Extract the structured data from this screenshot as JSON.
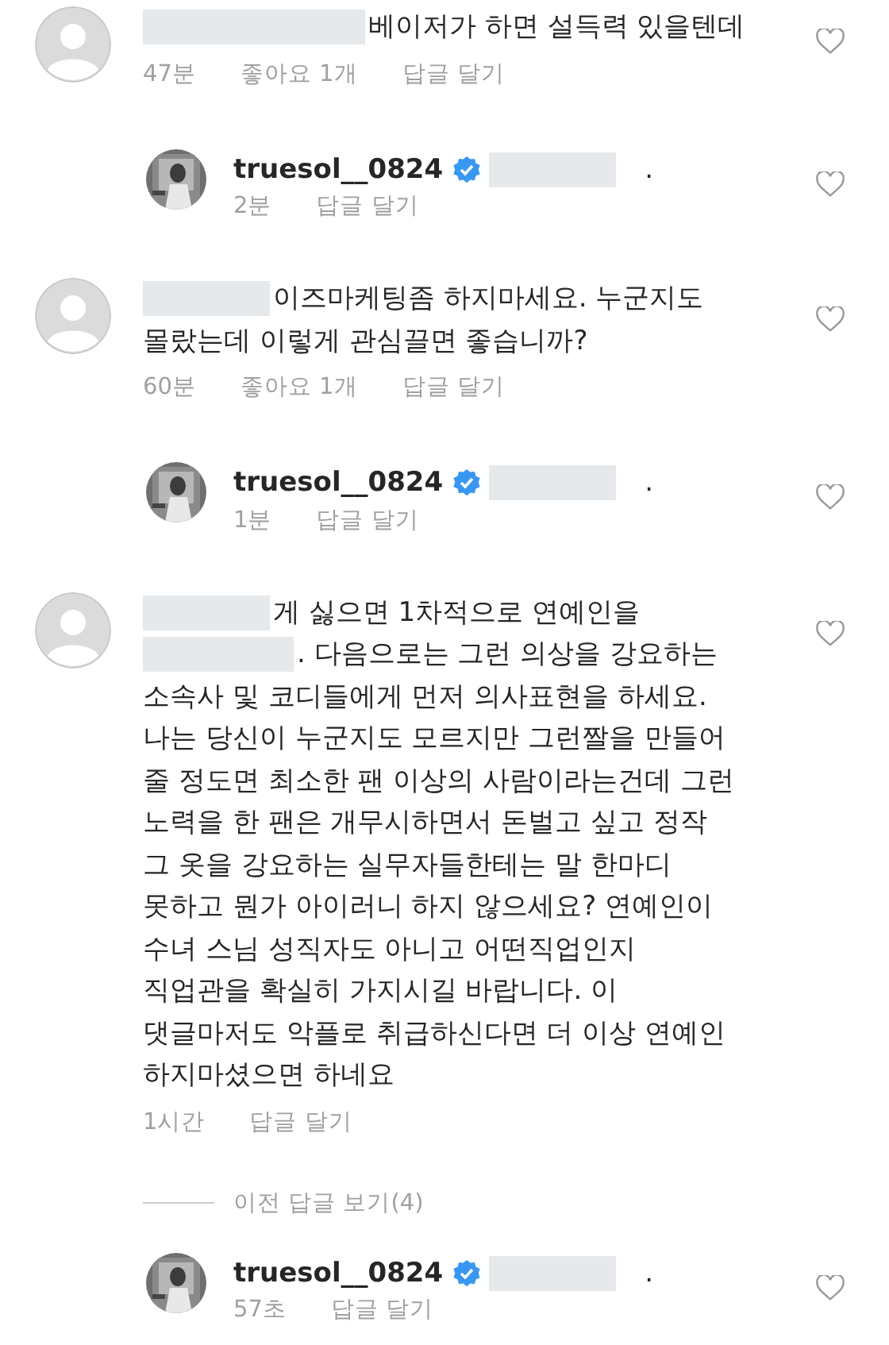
{
  "items": [
    {
      "kind": "comment",
      "lines": [
        {
          "text": "베이저가 하면 설득력 있을텐데",
          "redacted_before": true
        }
      ],
      "time": "47분",
      "likes": "좋아요 1개",
      "reply": "답글 달기"
    },
    {
      "kind": "reply",
      "username": "truesol__0824",
      "verified": true,
      "text": ".",
      "time": "2분",
      "reply": "답글 달기"
    },
    {
      "kind": "comment",
      "lines": [
        {
          "text": "이즈마케팅좀 하지마세요. 누군지도",
          "redacted_before": true
        },
        {
          "text": "몰랐는데 이렇게 관심끌면 좋습니까?",
          "redacted_before": false
        }
      ],
      "time": "60분",
      "likes": "좋아요 1개",
      "reply": "답글 달기"
    },
    {
      "kind": "reply",
      "username": "truesol__0824",
      "verified": true,
      "text": ".",
      "time": "1분",
      "reply": "답글 달기"
    },
    {
      "kind": "comment",
      "lines": [
        {
          "text": "게 싫으면 1차적으로 연예인을",
          "redacted_before": true
        },
        {
          "text": ". 다음으로는 그런 의상을 강요하는",
          "redacted_before": true
        },
        {
          "text": "소속사 및 코디들에게 먼저 의사표현을 하세요.",
          "redacted_before": false
        },
        {
          "text": "나는 당신이 누군지도 모르지만 그런짤을 만들어",
          "redacted_before": false
        },
        {
          "text": "줄 정도면 최소한 팬 이상의 사람이라는건데 그런",
          "redacted_before": false
        },
        {
          "text": "노력을 한 팬은 개무시하면서 돈벌고 싶고 정작",
          "redacted_before": false
        },
        {
          "text": "그 옷을 강요하는 실무자들한테는 말 한마디",
          "redacted_before": false
        },
        {
          "text": "못하고 뭔가 아이러니 하지 않으세요? 연예인이",
          "redacted_before": false
        },
        {
          "text": "수녀 스님 성직자도 아니고 어떤직업인지",
          "redacted_before": false
        },
        {
          "text": "직업관을 확실히 가지시길 바랍니다. 이",
          "redacted_before": false
        },
        {
          "text": "댓글마저도 악플로 취급하신다면 더 이상 연예인",
          "redacted_before": false
        },
        {
          "text": "하지마셨으면 하네요",
          "redacted_before": false
        }
      ],
      "time": "1시간",
      "reply": "답글 달기"
    },
    {
      "kind": "more",
      "label": "이전 답글 보기(4)"
    },
    {
      "kind": "reply",
      "username": "truesol__0824",
      "verified": true,
      "text": ".",
      "time": "57초",
      "reply": "답글 달기"
    }
  ]
}
